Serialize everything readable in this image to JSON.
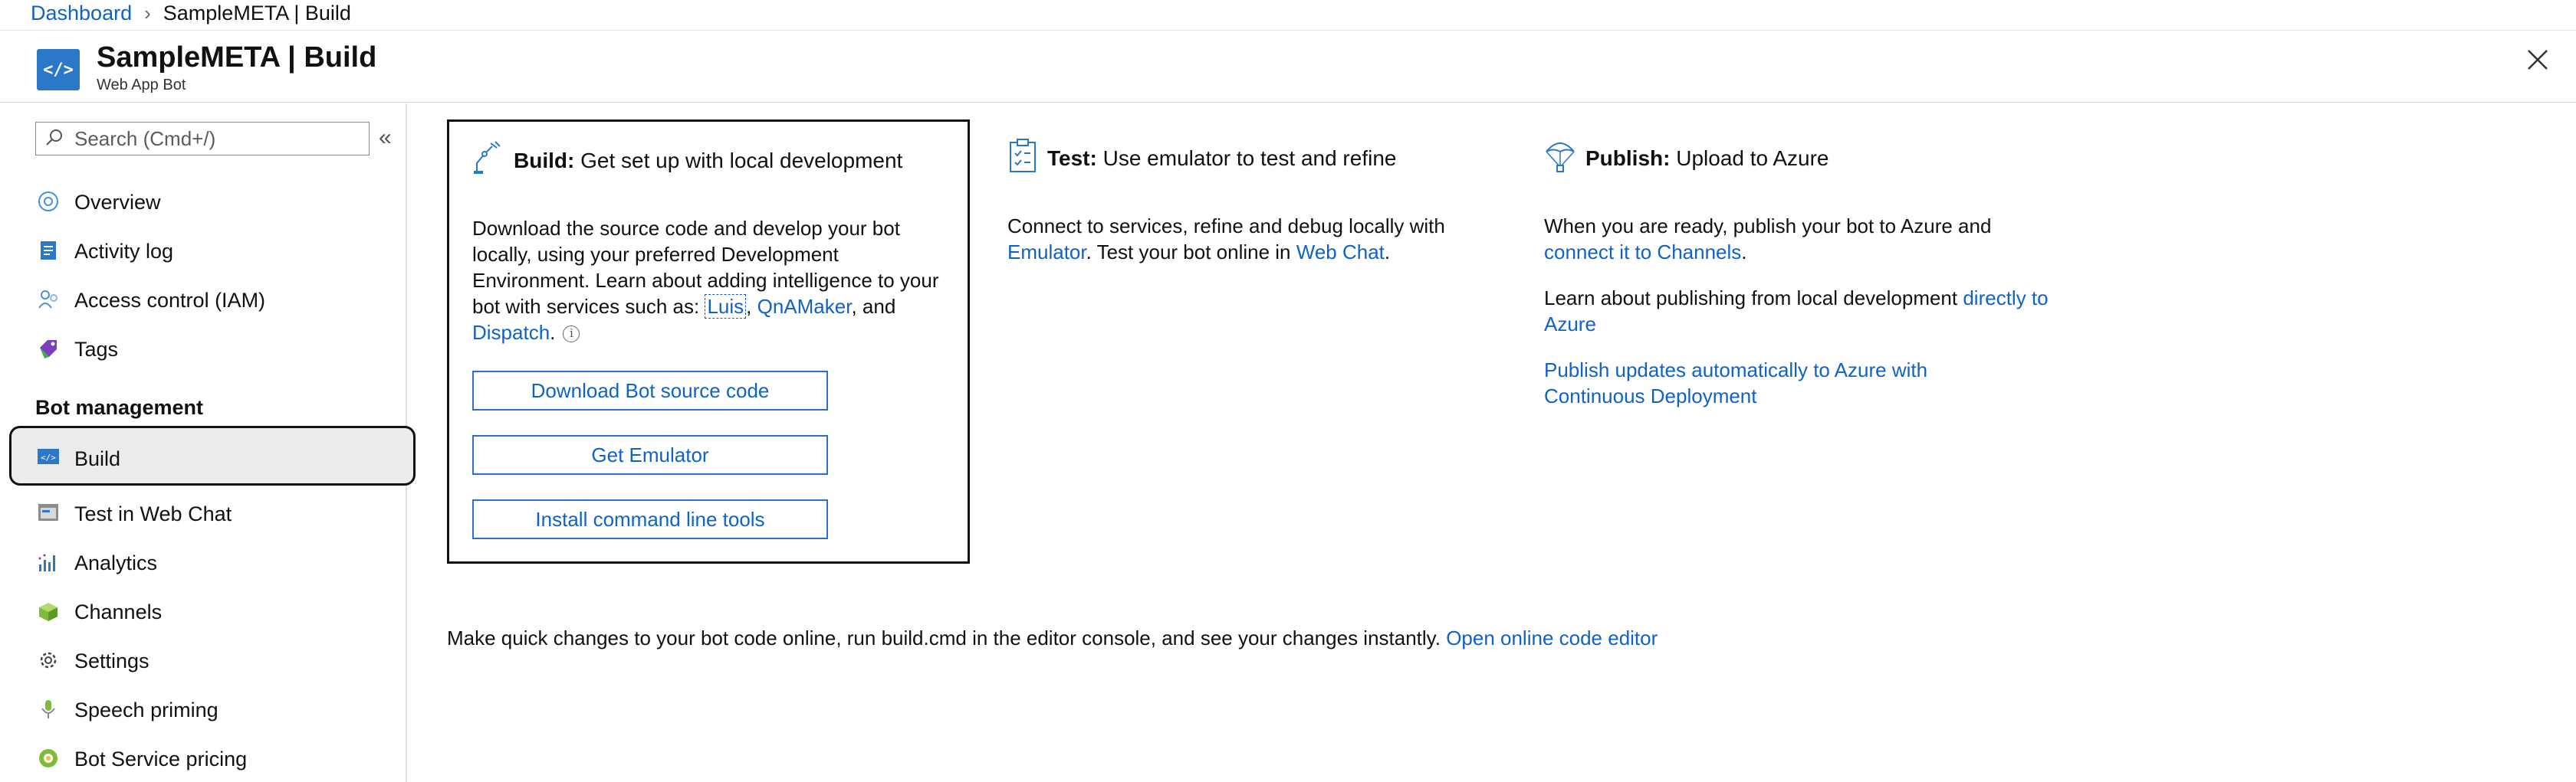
{
  "breadcrumb": {
    "root": "Dashboard",
    "current": "SampleMETA | Build"
  },
  "header": {
    "title": "SampleMETA | Build",
    "subtitle": "Web App Bot",
    "icon": "web-app-bot-icon"
  },
  "sidebar": {
    "search_placeholder": "Search (Cmd+/)",
    "items": [
      {
        "label": "Overview",
        "icon": "overview-icon"
      },
      {
        "label": "Activity log",
        "icon": "activity-log-icon"
      },
      {
        "label": "Access control (IAM)",
        "icon": "access-control-icon"
      },
      {
        "label": "Tags",
        "icon": "tag-icon"
      }
    ],
    "section_heading": "Bot management",
    "bot_items": [
      {
        "label": "Build",
        "icon": "build-icon",
        "selected": true
      },
      {
        "label": "Test in Web Chat",
        "icon": "web-chat-icon"
      },
      {
        "label": "Analytics",
        "icon": "analytics-icon"
      },
      {
        "label": "Channels",
        "icon": "channels-icon"
      },
      {
        "label": "Settings",
        "icon": "gear-icon"
      },
      {
        "label": "Speech priming",
        "icon": "speech-priming-icon"
      },
      {
        "label": "Bot Service pricing",
        "icon": "pricing-icon"
      }
    ]
  },
  "build": {
    "heading_bold": "Build:",
    "heading_rest": "Get set up with local development",
    "text_before": "Download the source code and develop your bot locally, using your preferred Development Environment. Learn about adding intelligence to your bot with services such as: ",
    "link_luis": "Luis",
    "comma": ", ",
    "link_qna": "QnAMaker",
    "and_text": ", and",
    "link_dispatch": "Dispatch",
    "period": ".",
    "buttons": [
      "Download Bot source code",
      "Get Emulator",
      "Install command line tools"
    ]
  },
  "test": {
    "heading_bold": "Test:",
    "heading_rest": "Use emulator to test and refine",
    "text1": "Connect to services, refine and debug locally with ",
    "link_emulator": "Emulator",
    "text2": ". Test your bot online in ",
    "link_webchat": "Web Chat",
    "text3": "."
  },
  "publish": {
    "heading_bold": "Publish:",
    "heading_rest": "Upload to Azure",
    "text1": "When you are ready, publish your bot to Azure and ",
    "link_channels": "connect it to Channels",
    "text1_end": ".",
    "text2": "Learn about publishing from local development ",
    "link_azure": "directly to Azure",
    "link_cd": "Publish updates automatically to Azure with Continuous Deployment"
  },
  "footer": {
    "text": "Make quick changes to your bot code online, run build.cmd in the editor console, and see your changes instantly. ",
    "link": "Open online code editor"
  },
  "colors": {
    "link": "#0f62c8",
    "accent": "#2b78c8"
  }
}
